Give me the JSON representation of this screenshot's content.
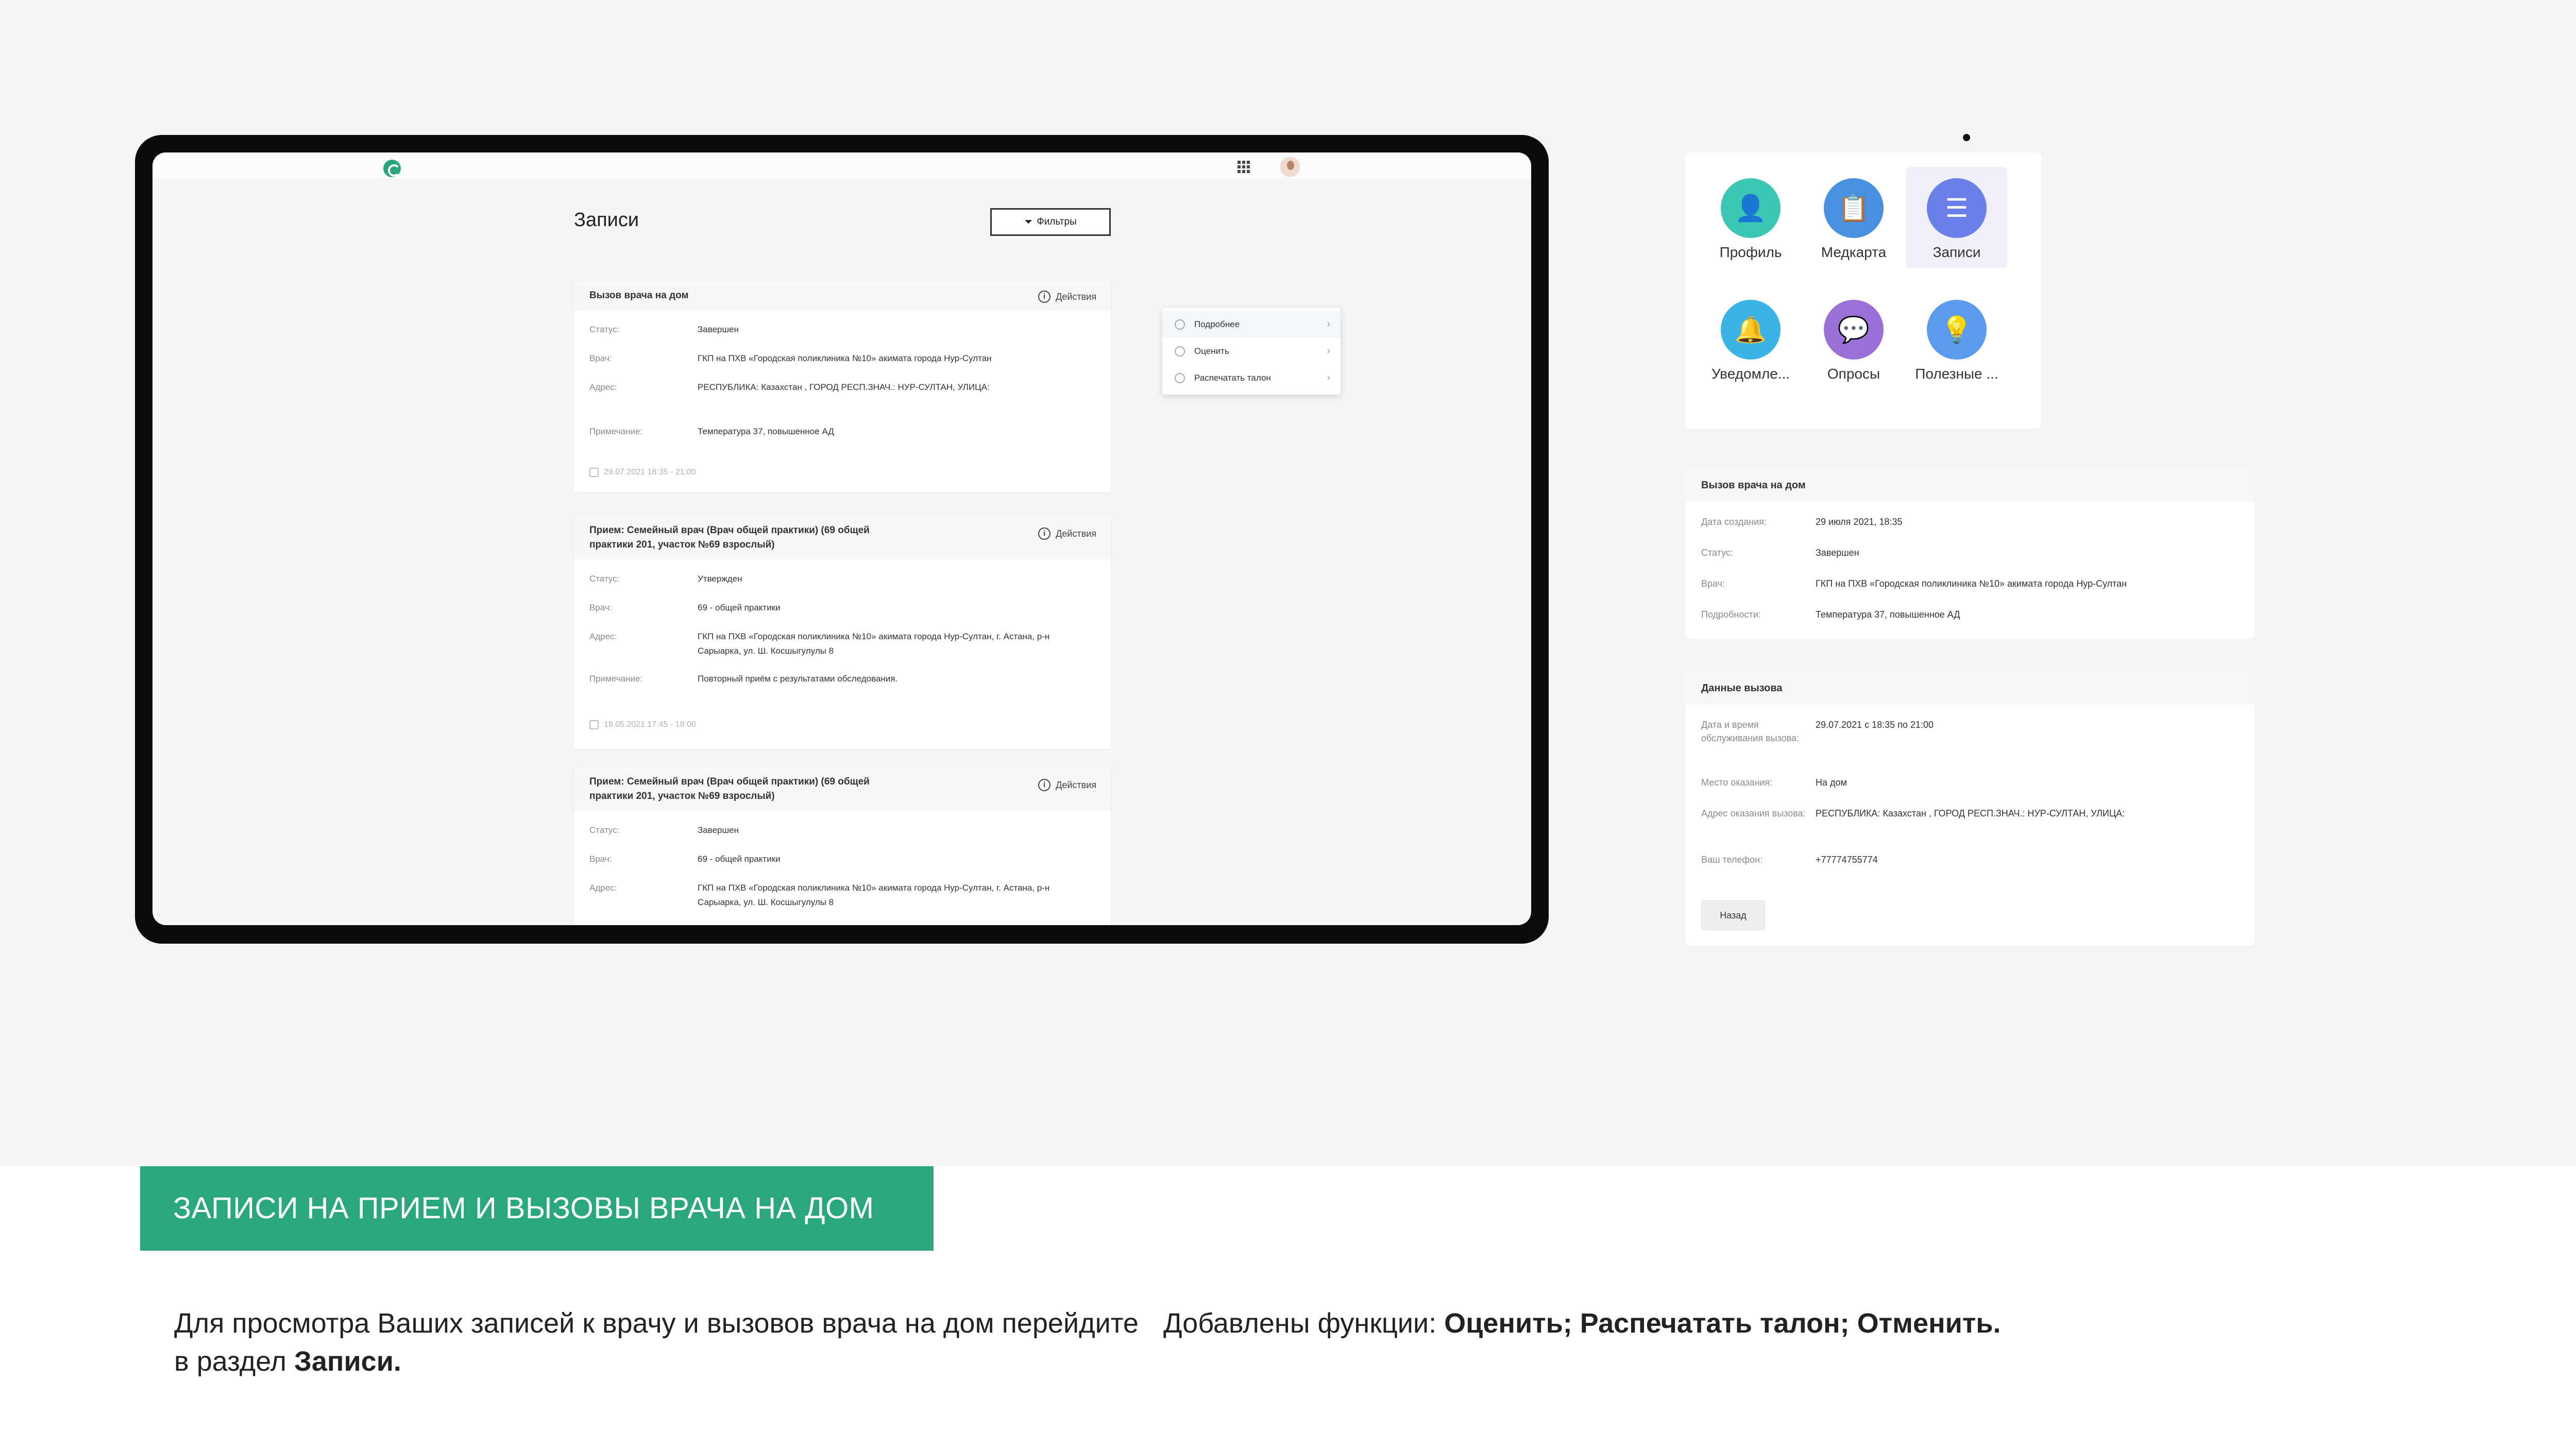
{
  "app": {
    "page_title": "Записи",
    "filters_label": "Фильтры",
    "actions_label": "Действия"
  },
  "cards": [
    {
      "title": "Вызов врача на дом",
      "rows": [
        {
          "label": "Статус:",
          "value": "Завершен"
        },
        {
          "label": "Врач:",
          "value": "ГКП на ПХВ «Городская поликлиника №10» акимата города Нур-Султан"
        },
        {
          "label": "Адрес:",
          "value": "РЕСПУБЛИКА: Казахстан , ГОРОД РЕСП.ЗНАЧ.: НУР-СУЛТАН, УЛИЦА:"
        },
        {
          "label": "Примечание:",
          "value": "Температура 37, повышенное АД"
        }
      ],
      "date": "29.07.2021 18:35 - 21:00"
    },
    {
      "title": "Прием: Семейный врач (Врач общей практики) (69 общей практики 201, участок №69 взрослый)",
      "rows": [
        {
          "label": "Статус:",
          "value": "Утвержден"
        },
        {
          "label": "Врач:",
          "value": "69 - общей практики"
        },
        {
          "label": "Адрес:",
          "value": "ГКП на ПХВ «Городская поликлиника №10» акимата города Нур-Султан, г. Астана, р-н Сарыарка, ул. Ш. Косшыгулулы 8"
        },
        {
          "label": "Примечание:",
          "value": "Повторный приём с результатами обследования."
        }
      ],
      "date": "18.05.2021 17:45 - 18:00"
    },
    {
      "title": "Прием: Семейный врач (Врач общей практики) (69 общей практики 201, участок №69 взрослый)",
      "rows": [
        {
          "label": "Статус:",
          "value": "Завершен"
        },
        {
          "label": "Врач:",
          "value": "69 - общей практики"
        },
        {
          "label": "Адрес:",
          "value": "ГКП на ПХВ «Городская поликлиника №10» акимата города Нур-Султан, г. Астана, р-н Сарыарка, ул. Ш. Косшыгулулы 8"
        }
      ]
    }
  ],
  "dropdown": {
    "items": [
      {
        "label": "Подробнее",
        "icon": "eye-icon"
      },
      {
        "label": "Оценить",
        "icon": "thumbs-up-icon"
      },
      {
        "label": "Распечатать талон",
        "icon": "printer-icon"
      }
    ]
  },
  "menu": {
    "tiles": [
      {
        "label": "Профиль",
        "icon": "user-icon",
        "color": "#3cc7b4"
      },
      {
        "label": "Медкарта",
        "icon": "clipboard-icon",
        "color": "#4a90e2"
      },
      {
        "label": "Записи",
        "icon": "list-icon",
        "color": "#6b7fe8"
      },
      {
        "label": "Уведомле...",
        "icon": "bell-icon",
        "color": "#3ab4e6"
      },
      {
        "label": "Опросы",
        "icon": "chat-icon",
        "color": "#9b6fd8"
      },
      {
        "label": "Полезные ...",
        "icon": "lightbulb-icon",
        "color": "#5b9bef"
      }
    ]
  },
  "detail_panel": {
    "title": "Вызов врача на дом",
    "rows": [
      {
        "label": "Дата создания:",
        "value": "29 июля 2021, 18:35"
      },
      {
        "label": "Статус:",
        "value": "Завершен"
      },
      {
        "label": "Врач:",
        "value": "ГКП на ПХВ «Городская поликлиника №10» акимата города Нур-Султан"
      },
      {
        "label": "Подробности:",
        "value": "Температура 37, повышенное АД"
      }
    ]
  },
  "call_panel": {
    "title": "Данные вызова",
    "rows": [
      {
        "label": "Дата и время обслуживания вызова:",
        "value": "29.07.2021 с 18:35 по 21:00"
      },
      {
        "label": "Место оказания:",
        "value": "На дом"
      },
      {
        "label": "Адрес оказания вызова:",
        "value": "РЕСПУБЛИКА: Казахстан , ГОРОД РЕСП.ЗНАЧ.: НУР-СУЛТАН, УЛИЦА:"
      },
      {
        "label": "Ваш телефон:",
        "value": "+77774755774"
      }
    ],
    "back_label": "Назад"
  },
  "banner": {
    "text": "ЗАПИСИ НА ПРИЕМ И ВЫЗОВЫ ВРАЧА НА ДОМ"
  },
  "captions": {
    "left_part1": "Для просмотра Ваших записей к врачу и вызовов врача на дом перейдите в раздел ",
    "left_bold": "Записи.",
    "right_part1": "Добавлены функции: ",
    "right_bold": "Оценить; Распечатать талон; Отменить."
  },
  "colors": {
    "accent": "#2aa87c"
  }
}
